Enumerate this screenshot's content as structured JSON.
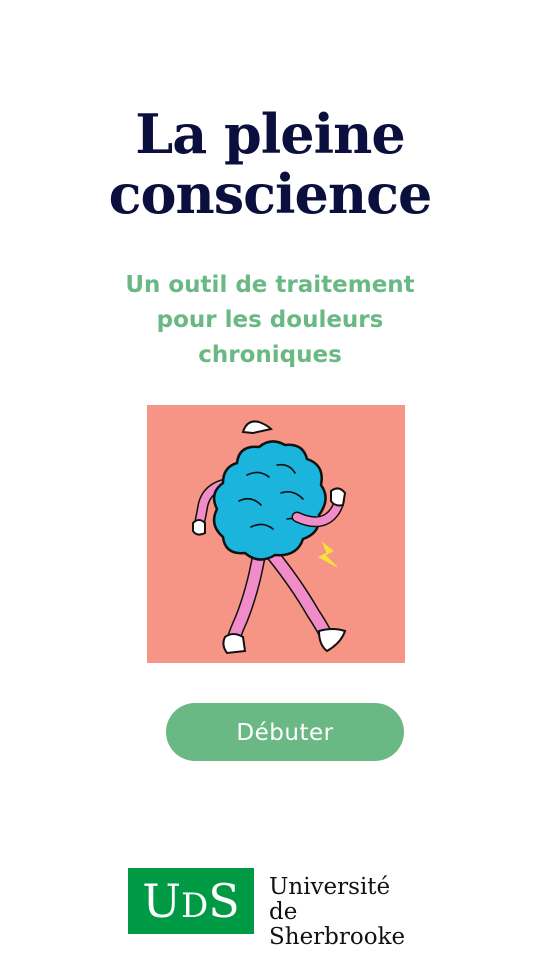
{
  "title": {
    "line1": "La pleine",
    "line2": "conscience"
  },
  "subtitle": {
    "line1": "Un outil de traitement",
    "line2": "pour les douleurs",
    "line3": "chroniques"
  },
  "illustration": {
    "icon": "walking-brain-illustration",
    "background": "#f69585",
    "brain_color": "#1ab4dc",
    "limb_color": "#f28cc8"
  },
  "start_button": {
    "label": "Débuter",
    "color": "#6ab884"
  },
  "logo": {
    "mark_u": "U",
    "mark_d": "D",
    "mark_s": "S",
    "name_line1": "Université de",
    "name_line2": "Sherbrooke",
    "color": "#009a44"
  }
}
